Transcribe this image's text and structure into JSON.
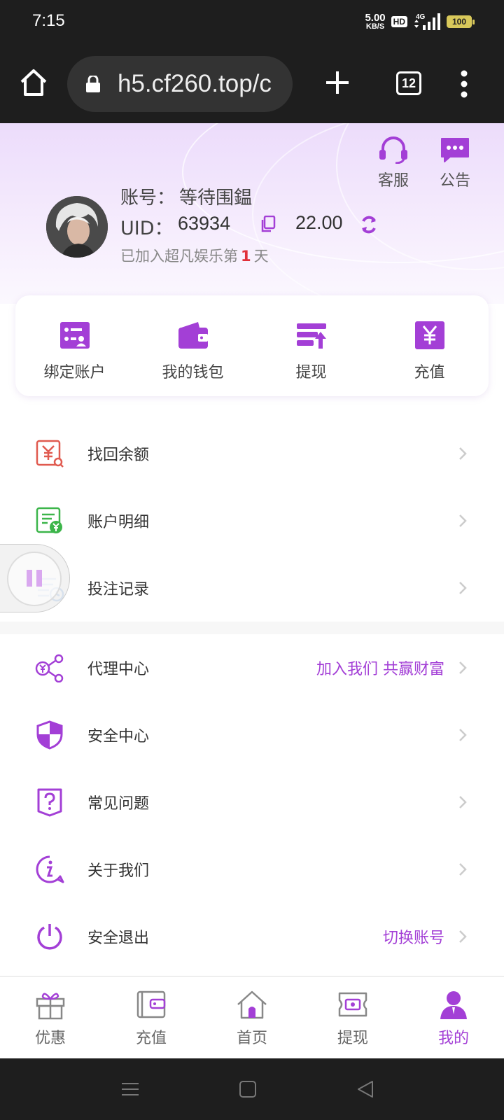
{
  "status_bar": {
    "time": "7:15",
    "net_speed_value": "5.00",
    "net_speed_unit": "KB/S",
    "hd_badge": "HD",
    "network_type": "4G",
    "battery": "100"
  },
  "browser": {
    "url": "h5.cf260.top/c",
    "tab_count": "12"
  },
  "header": {
    "service_label": "客服",
    "notice_label": "公告",
    "account_label": "账号：",
    "account_name": "等待围鎾",
    "uid_label": "UID：",
    "uid_value": "63934",
    "balance": "22.00",
    "joined_prefix": "已加入超凡娱乐第",
    "joined_days": "1",
    "joined_suffix": "天"
  },
  "quick_actions": [
    {
      "label": "绑定账户",
      "icon": "bind-account-icon"
    },
    {
      "label": "我的钱包",
      "icon": "wallet-icon"
    },
    {
      "label": "提现",
      "icon": "withdraw-icon"
    },
    {
      "label": "充值",
      "icon": "recharge-icon"
    }
  ],
  "menu_group_1": [
    {
      "label": "找回余额",
      "icon": "recover-balance-icon",
      "color": "#e05a4f"
    },
    {
      "label": "账户明细",
      "icon": "account-detail-icon",
      "color": "#3cb54a"
    },
    {
      "label": "投注记录",
      "icon": "bet-record-icon",
      "color": "#4a90d9"
    }
  ],
  "menu_group_2": [
    {
      "label": "代理中心",
      "extra": "加入我们 共赢财富",
      "icon": "agent-icon"
    },
    {
      "label": "安全中心",
      "extra": "",
      "icon": "shield-icon"
    },
    {
      "label": "常见问题",
      "extra": "",
      "icon": "faq-icon"
    },
    {
      "label": "关于我们",
      "extra": "",
      "icon": "info-icon"
    },
    {
      "label": "安全退出",
      "extra": "切换账号",
      "icon": "power-icon"
    }
  ],
  "bottom_nav": [
    {
      "label": "优惠",
      "icon": "gift-icon",
      "active": false
    },
    {
      "label": "充值",
      "icon": "wallet-icon",
      "active": false
    },
    {
      "label": "首页",
      "icon": "home-icon",
      "active": false
    },
    {
      "label": "提现",
      "icon": "ticket-icon",
      "active": false
    },
    {
      "label": "我的",
      "icon": "user-icon",
      "active": true
    }
  ],
  "colors": {
    "accent": "#a33fd6",
    "header_bg": "#ecdcfb",
    "highlight_red": "#e0303a"
  }
}
